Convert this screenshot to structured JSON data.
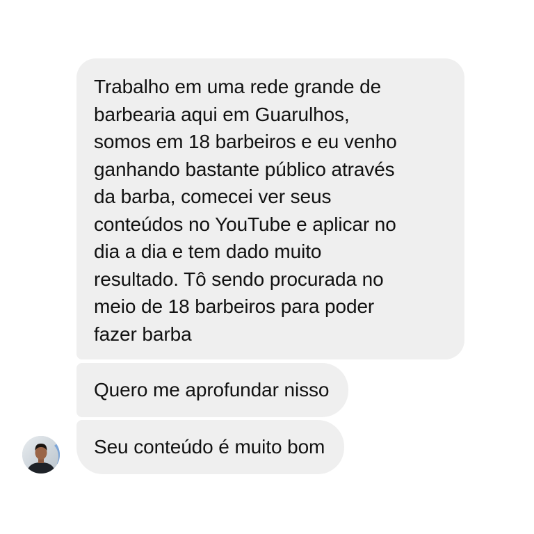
{
  "conversation": {
    "messages": [
      {
        "sender": "other",
        "text": "Trabalho em uma rede grande de\nbarbearia aqui em Guarulhos,\nsomos em 18 barbeiros e eu venho\nganhando bastante público através\nda barba, comecei ver seus\nconteúdos no YouTube e aplicar no\ndia a dia e tem dado muito\nresultado. Tô sendo procurada no\nmeio de 18 barbeiros para poder\nfazer barba"
      },
      {
        "sender": "other",
        "text": "Quero me aprofundar nisso"
      },
      {
        "sender": "other",
        "text": "Seu conteúdo é muito bom"
      }
    ],
    "avatar": {
      "icon": "profile-avatar"
    }
  },
  "colors": {
    "background": "#ffffff",
    "bubble": "#efefef",
    "text": "#111111"
  }
}
